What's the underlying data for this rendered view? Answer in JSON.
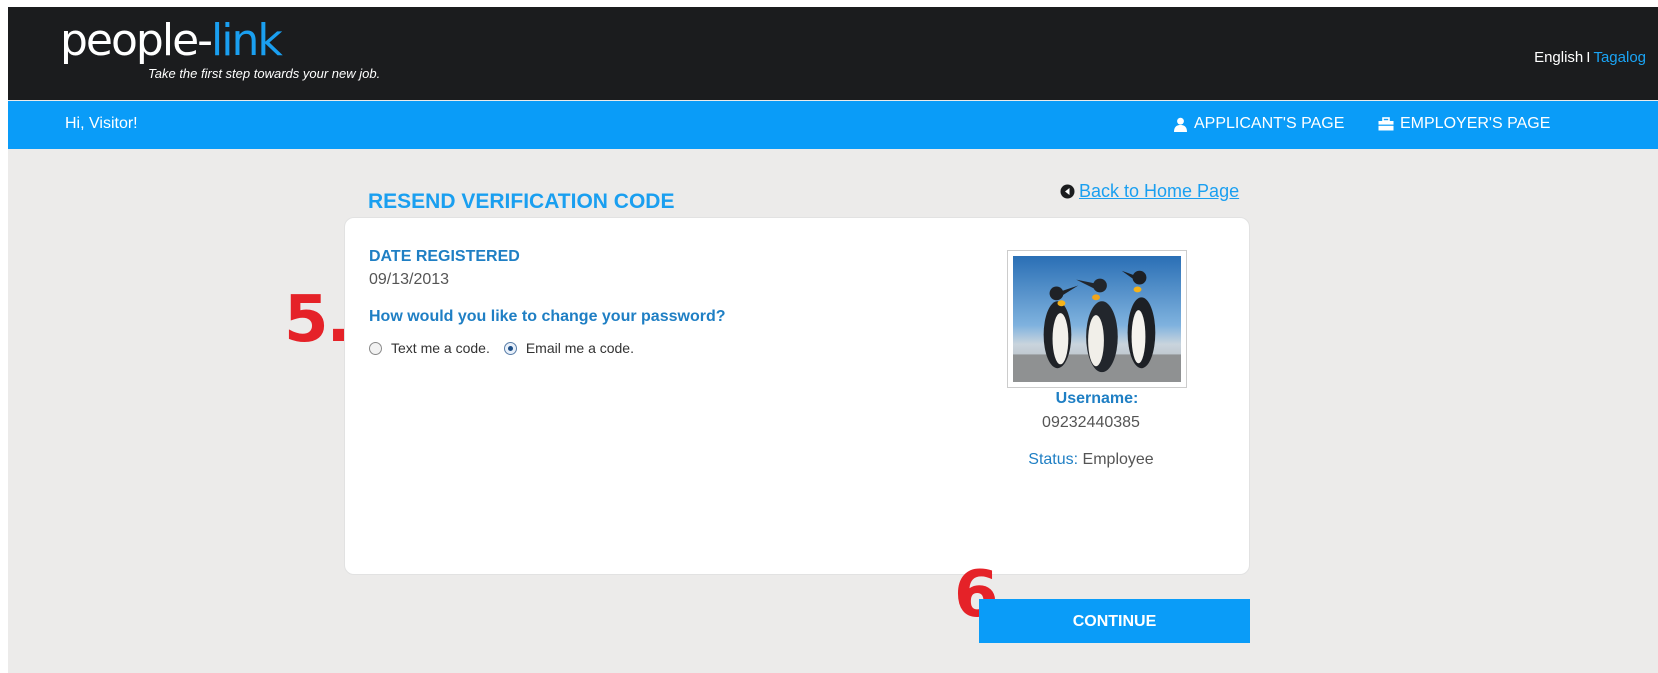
{
  "header": {
    "logo_main": "people-",
    "logo_accent": "link",
    "tagline": "Take the first step towards your new job.",
    "lang_english": "English",
    "lang_separator": "I",
    "lang_tagalog": "Tagalog"
  },
  "nav": {
    "greeting": "Hi, Visitor!",
    "applicant_label": "APPLICANT'S PAGE",
    "employer_label": "EMPLOYER'S PAGE"
  },
  "page": {
    "title": "RESEND VERIFICATION CODE",
    "back_link": " Back to Home Page"
  },
  "form": {
    "date_label": "DATE REGISTERED",
    "date_value": "09/13/2013",
    "question": "How would you like to change your password?",
    "options": [
      {
        "label": "Text me a code.",
        "checked": false
      },
      {
        "label": "Email me a code.",
        "checked": true
      }
    ]
  },
  "profile": {
    "username_label": "Username:",
    "username_value": "09232440385",
    "status_label": "Status:",
    "status_value": "Employee"
  },
  "annotations": {
    "step5": "5.",
    "step6": "6."
  },
  "actions": {
    "continue_label": "CONTINUE"
  },
  "colors": {
    "accent": "#0a9cf8",
    "header_dark": "#1b1c1e",
    "label_blue": "#1f7fc4",
    "annotation_red": "#e52228"
  }
}
